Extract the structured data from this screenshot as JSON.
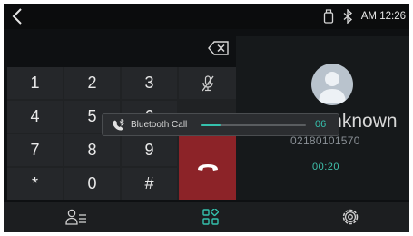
{
  "status_bar": {
    "back_icon": "chevron-left-icon",
    "usb_icon": "usb-drive-icon",
    "bluetooth_icon": "bluetooth-icon",
    "time": "AM 12:26"
  },
  "dialer": {
    "delete_icon": "backspace-icon",
    "keys": [
      "1",
      "2",
      "3",
      "4",
      "5",
      "6",
      "7",
      "8",
      "9",
      "*",
      "0",
      "#"
    ],
    "mute_icon": "mic-off-icon",
    "end_call_icon": "call-end-icon",
    "end_call_color": "#8c2328"
  },
  "contact": {
    "avatar_icon": "person-icon",
    "name": "Unknown",
    "number": "02180101570",
    "duration": "00:20"
  },
  "volume_overlay": {
    "icon": "bluetooth-call-icon",
    "label": "Bluetooth Call",
    "value": "06",
    "level_fraction": 0.19
  },
  "bottom_nav": {
    "items": [
      {
        "icon": "contacts-icon"
      },
      {
        "icon": "keypad-grid-icon",
        "active": true
      },
      {
        "icon": "settings-icon"
      }
    ]
  },
  "colors": {
    "accent": "#35c1ad",
    "background": "#0e1012",
    "end_call": "#8c2328"
  }
}
